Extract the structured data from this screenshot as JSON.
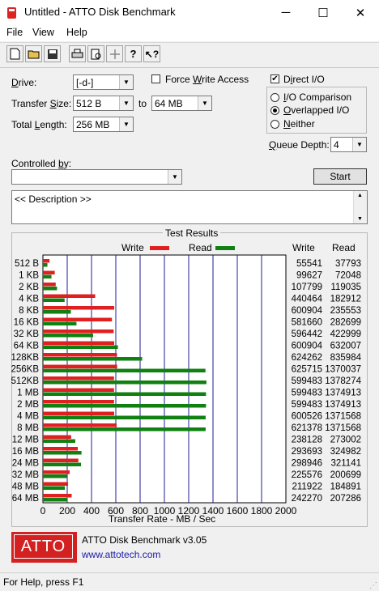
{
  "window": {
    "title": "Untitled - ATTO Disk Benchmark",
    "minimize": "─",
    "maximize": "☐",
    "close": "✕"
  },
  "menu": [
    "File",
    "View",
    "Help"
  ],
  "toolbar": [
    {
      "name": "new-icon",
      "glyph": "🗋"
    },
    {
      "name": "open-icon",
      "glyph": "📂"
    },
    {
      "name": "save-icon",
      "glyph": "💾"
    },
    {
      "name": "print-icon",
      "glyph": "🖶"
    },
    {
      "name": "print-preview-icon",
      "glyph": "🔍"
    },
    {
      "name": "move-icon",
      "glyph": "✥"
    },
    {
      "name": "help-icon",
      "glyph": "?"
    },
    {
      "name": "context-help-icon",
      "glyph": "↖?"
    }
  ],
  "form": {
    "drive_label": "Drive:",
    "drive_value": "[-d-]",
    "transfer_label": "Transfer Size:",
    "transfer_from": "512 B",
    "to_label": "to",
    "transfer_to": "64 MB",
    "length_label": "Total Length:",
    "length_value": "256 MB",
    "force_write": "Force Write Access",
    "direct_io": "Direct I/O",
    "io_comparison": "I/O Comparison",
    "overlapped_io": "Overlapped I/O",
    "neither": "Neither",
    "queue_label": "Queue Depth:",
    "queue_value": "4",
    "controlled_label": "Controlled by:",
    "controlled_value": "",
    "start": "Start",
    "description": "<< Description >>"
  },
  "results": {
    "title": "Test Results",
    "write_legend": "Write",
    "read_legend": "Read",
    "write_col": "Write",
    "read_col": "Read",
    "write_color": "#e02020",
    "read_color": "#108010"
  },
  "chart_data": {
    "type": "bar",
    "orientation": "horizontal",
    "categories": [
      "512 B",
      "1 KB",
      "2 KB",
      "4 KB",
      "8 KB",
      "16 KB",
      "32 KB",
      "64 KB",
      "128KB",
      "256KB",
      "512KB",
      "1 MB",
      "2 MB",
      "4 MB",
      "8 MB",
      "12 MB",
      "16 MB",
      "24 MB",
      "32 MB",
      "48 MB",
      "64 MB"
    ],
    "series": [
      {
        "name": "Write",
        "values": [
          55541,
          99627,
          107799,
          440464,
          600904,
          581660,
          596442,
          600904,
          624262,
          625715,
          599483,
          599483,
          599483,
          600526,
          621378,
          238128,
          293693,
          298946,
          225576,
          211922,
          242270
        ]
      },
      {
        "name": "Read",
        "values": [
          37793,
          72048,
          119035,
          182912,
          235553,
          282699,
          422999,
          632007,
          835984,
          1370037,
          1378274,
          1374913,
          1374913,
          1371568,
          1371568,
          273002,
          324982,
          321141,
          200699,
          184891,
          207286
        ]
      }
    ],
    "write_text": [
      "55541",
      "99627",
      "107799",
      "440464",
      "600904",
      "581660",
      "596442",
      "600904",
      "624262",
      "625715",
      "599483",
      "599483",
      "599483",
      "600526",
      "621378",
      "238128",
      "293693",
      "298946",
      "225576",
      "211922",
      "242270"
    ],
    "read_text": [
      "37793",
      "72048",
      "119035",
      "182912",
      "235553",
      "282699",
      "422999",
      "632007",
      "835984",
      "1370037",
      "1378274",
      "1374913",
      "1374913",
      "1371568",
      "1371568",
      "273002",
      "324982",
      "321141",
      "200699",
      "184891",
      "207286"
    ],
    "xticks": [
      "0",
      "200",
      "400",
      "600",
      "800",
      "1000",
      "1200",
      "1400",
      "1600",
      "1800",
      "2000"
    ],
    "xlim": [
      0,
      2000
    ],
    "xlabel": "Transfer Rate - MB / Sec"
  },
  "footer": {
    "logo": "ATTO",
    "product": "ATTO Disk Benchmark v3.05",
    "url": "www.attotech.com"
  },
  "status": "For Help, press F1"
}
